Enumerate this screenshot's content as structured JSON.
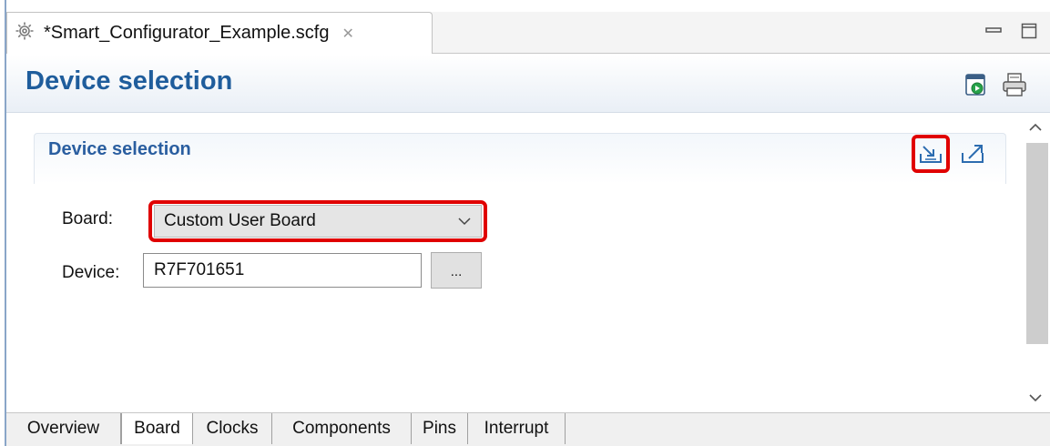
{
  "editor_tab": {
    "title": "*Smart_Configurator_Example.scfg",
    "icon": "gear-icon",
    "close_icon": "close-icon"
  },
  "window_controls": {
    "minimize_icon": "minimize-icon",
    "maximize_icon": "maximize-icon"
  },
  "form": {
    "title": "Device selection",
    "toolbar_icons": [
      "generate-code-icon",
      "print-icon"
    ]
  },
  "section": {
    "title": "Device selection",
    "buttons": [
      "import-board-icon",
      "export-board-icon"
    ]
  },
  "fields": {
    "board_label": "Board:",
    "board_value": "Custom User Board",
    "device_label": "Device:",
    "device_value": "R7F701651",
    "browse_label": "..."
  },
  "page_tabs": [
    {
      "label": "Overview",
      "active": false
    },
    {
      "label": "Board",
      "active": true
    },
    {
      "label": "Clocks",
      "active": false
    },
    {
      "label": "Components",
      "active": false
    },
    {
      "label": "Pins",
      "active": false
    },
    {
      "label": "Interrupt",
      "active": false
    }
  ],
  "colors": {
    "title_blue": "#1f5d9c",
    "highlight_red": "#e00000"
  }
}
